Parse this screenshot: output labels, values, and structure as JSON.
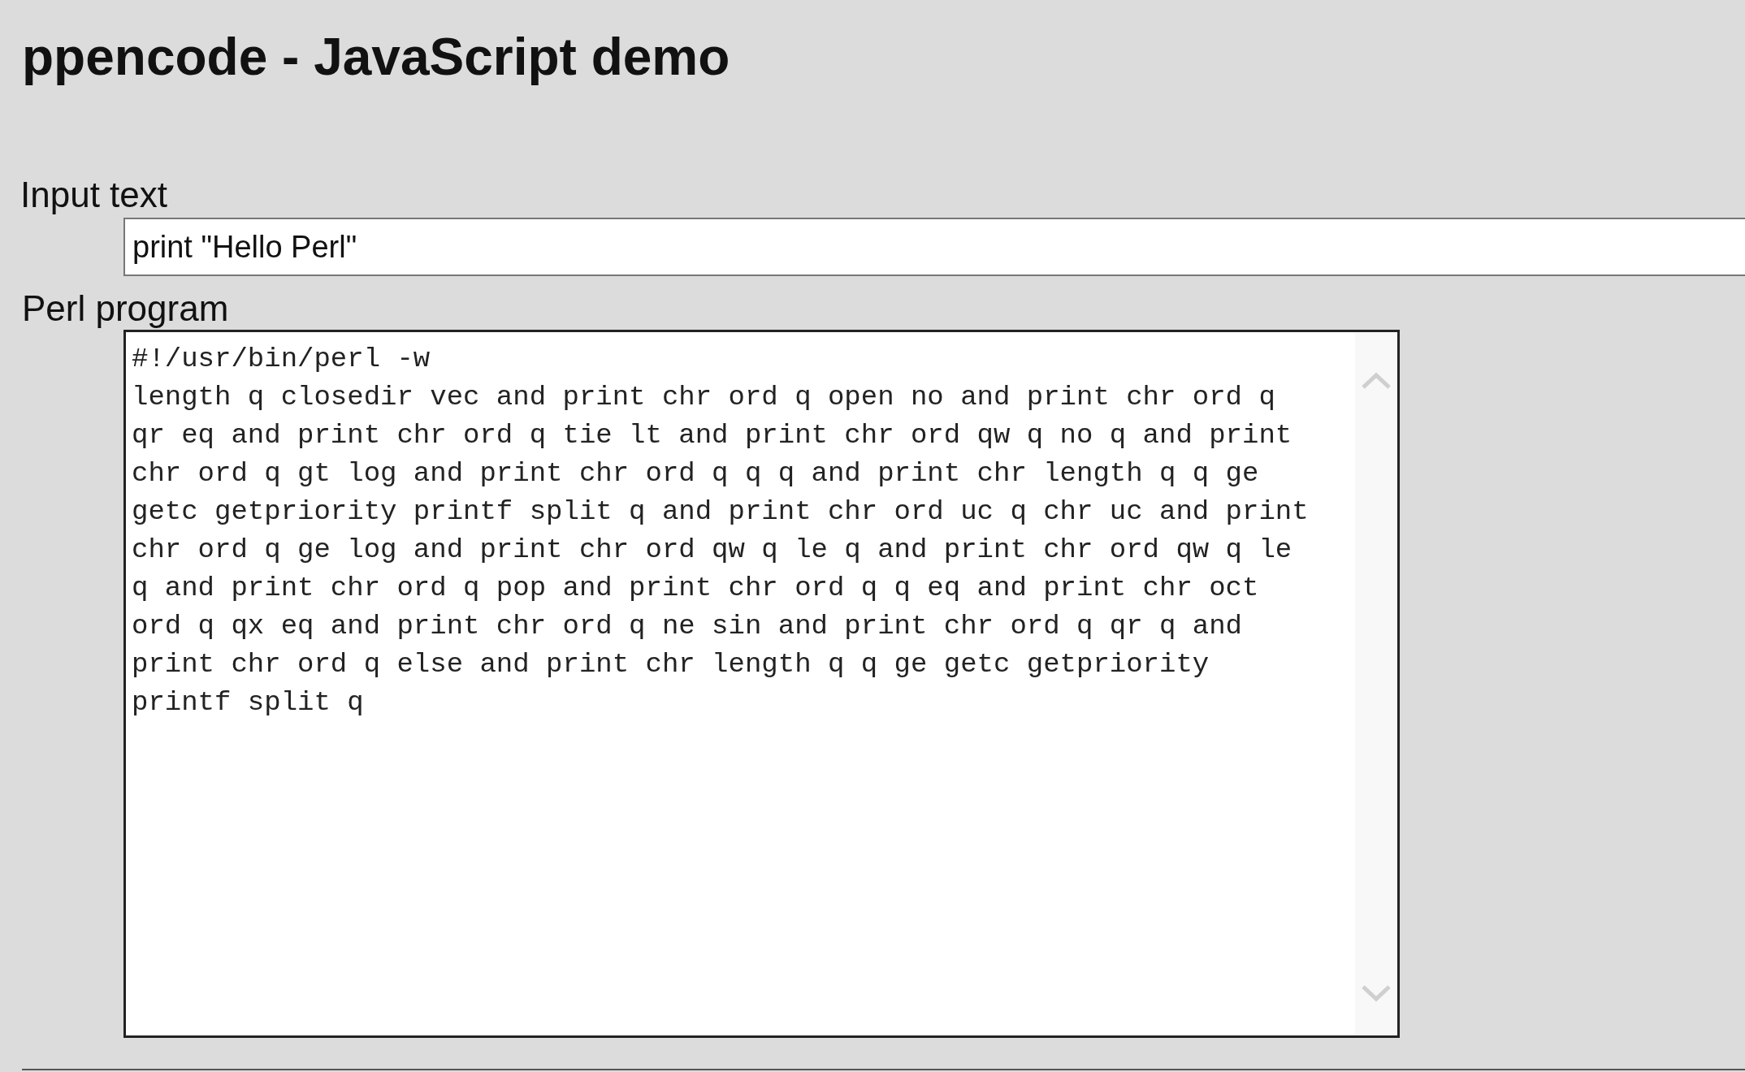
{
  "title": "ppencode - JavaScript demo",
  "input": {
    "label": "Input text",
    "value": "print \"Hello Perl\""
  },
  "program": {
    "label": "Perl program",
    "lines": [
      "#!/usr/bin/perl -w",
      "length q closedir vec and print chr ord q open no and print chr ord q",
      "qr eq and print chr ord q tie lt and print chr ord qw q no q and print",
      "chr ord q gt log and print chr ord q q q and print chr length q q ge",
      "getc getpriority printf split q and print chr ord uc q chr uc and print",
      "chr ord q ge log and print chr ord qw q le q and print chr ord qw q le",
      "q and print chr ord q pop and print chr ord q q eq and print chr oct",
      "ord q qx eq and print chr ord q ne sin and print chr ord q qr q and",
      "print chr ord q else and print chr length q q ge getc getpriority",
      "printf split q"
    ]
  }
}
